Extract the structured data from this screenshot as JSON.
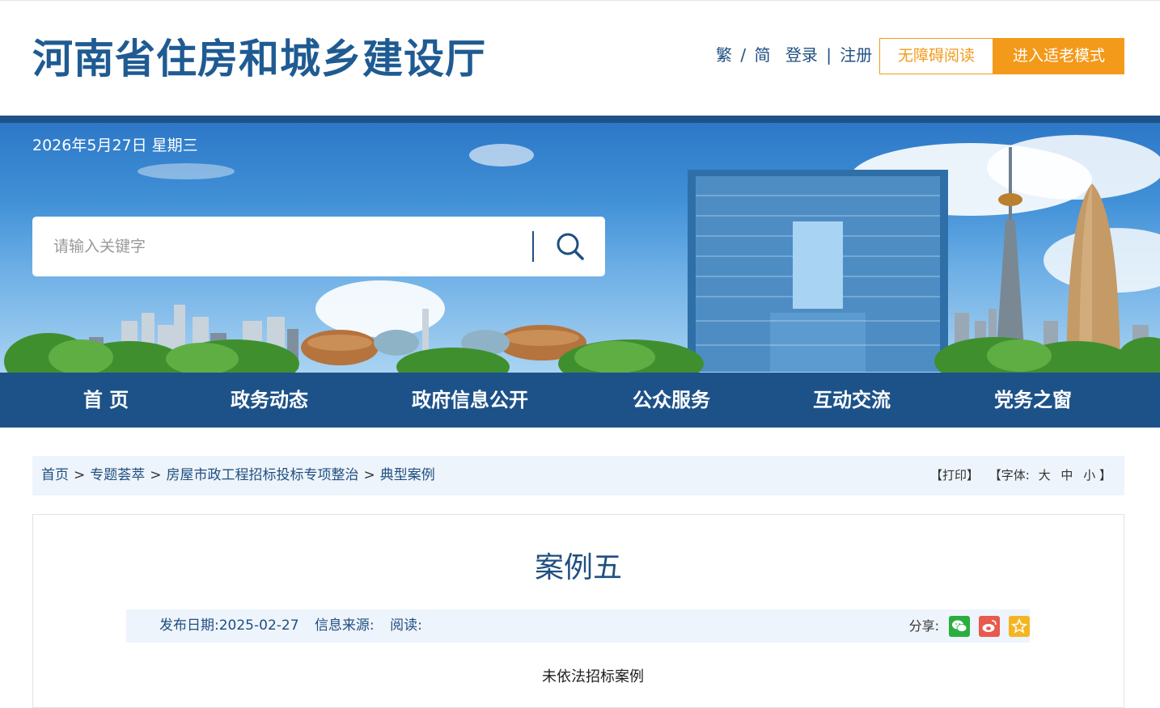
{
  "header": {
    "site_title": "河南省住房和城乡建设厅",
    "lang_trad": "繁",
    "lang_sep": "/",
    "lang_simp": "简",
    "login": "登录",
    "auth_sep": "|",
    "register": "注册",
    "accessibility_button": "无障碍阅读",
    "elder_mode_button": "进入适老模式"
  },
  "banner": {
    "date": "2026年5月27日 星期三",
    "search_placeholder": "请输入关键字"
  },
  "nav": {
    "items": [
      "首 页",
      "政务动态",
      "政府信息公开",
      "公众服务",
      "互动交流",
      "党务之窗"
    ]
  },
  "breadcrumb": {
    "items": [
      "首页",
      "专题荟萃",
      "房屋市政工程招标投标专项整治",
      "典型案例"
    ],
    "separator": ">",
    "print": "【打印】",
    "font_label": "【字体:",
    "font_large": "大",
    "font_medium": "中",
    "font_small": "小",
    "font_close": "】"
  },
  "article": {
    "title": "案例五",
    "publish_date": "发布日期:2025-02-27",
    "source": "信息来源:",
    "reads": "阅读:",
    "share_label": "分享:",
    "subtitle": "未依法招标案例"
  },
  "colors": {
    "brand_blue": "#1d5289",
    "accent_orange": "#f39a1a",
    "wechat_green": "#2aae3f",
    "weibo_red": "#e8594e",
    "fav_yellow": "#f5b522"
  }
}
